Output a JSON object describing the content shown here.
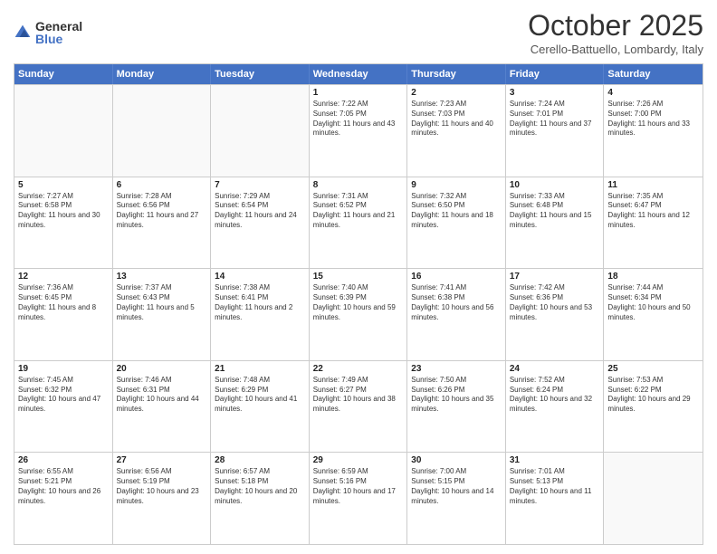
{
  "logo": {
    "general": "General",
    "blue": "Blue"
  },
  "header": {
    "month": "October 2025",
    "location": "Cerello-Battuello, Lombardy, Italy"
  },
  "days_of_week": [
    "Sunday",
    "Monday",
    "Tuesday",
    "Wednesday",
    "Thursday",
    "Friday",
    "Saturday"
  ],
  "rows": [
    [
      {
        "day": "",
        "empty": true
      },
      {
        "day": "",
        "empty": true
      },
      {
        "day": "",
        "empty": true
      },
      {
        "day": "1",
        "sunrise": "7:22 AM",
        "sunset": "7:05 PM",
        "daylight": "11 hours and 43 minutes."
      },
      {
        "day": "2",
        "sunrise": "7:23 AM",
        "sunset": "7:03 PM",
        "daylight": "11 hours and 40 minutes."
      },
      {
        "day": "3",
        "sunrise": "7:24 AM",
        "sunset": "7:01 PM",
        "daylight": "11 hours and 37 minutes."
      },
      {
        "day": "4",
        "sunrise": "7:26 AM",
        "sunset": "7:00 PM",
        "daylight": "11 hours and 33 minutes."
      }
    ],
    [
      {
        "day": "5",
        "sunrise": "7:27 AM",
        "sunset": "6:58 PM",
        "daylight": "11 hours and 30 minutes."
      },
      {
        "day": "6",
        "sunrise": "7:28 AM",
        "sunset": "6:56 PM",
        "daylight": "11 hours and 27 minutes."
      },
      {
        "day": "7",
        "sunrise": "7:29 AM",
        "sunset": "6:54 PM",
        "daylight": "11 hours and 24 minutes."
      },
      {
        "day": "8",
        "sunrise": "7:31 AM",
        "sunset": "6:52 PM",
        "daylight": "11 hours and 21 minutes."
      },
      {
        "day": "9",
        "sunrise": "7:32 AM",
        "sunset": "6:50 PM",
        "daylight": "11 hours and 18 minutes."
      },
      {
        "day": "10",
        "sunrise": "7:33 AM",
        "sunset": "6:48 PM",
        "daylight": "11 hours and 15 minutes."
      },
      {
        "day": "11",
        "sunrise": "7:35 AM",
        "sunset": "6:47 PM",
        "daylight": "11 hours and 12 minutes."
      }
    ],
    [
      {
        "day": "12",
        "sunrise": "7:36 AM",
        "sunset": "6:45 PM",
        "daylight": "11 hours and 8 minutes."
      },
      {
        "day": "13",
        "sunrise": "7:37 AM",
        "sunset": "6:43 PM",
        "daylight": "11 hours and 5 minutes."
      },
      {
        "day": "14",
        "sunrise": "7:38 AM",
        "sunset": "6:41 PM",
        "daylight": "11 hours and 2 minutes."
      },
      {
        "day": "15",
        "sunrise": "7:40 AM",
        "sunset": "6:39 PM",
        "daylight": "10 hours and 59 minutes."
      },
      {
        "day": "16",
        "sunrise": "7:41 AM",
        "sunset": "6:38 PM",
        "daylight": "10 hours and 56 minutes."
      },
      {
        "day": "17",
        "sunrise": "7:42 AM",
        "sunset": "6:36 PM",
        "daylight": "10 hours and 53 minutes."
      },
      {
        "day": "18",
        "sunrise": "7:44 AM",
        "sunset": "6:34 PM",
        "daylight": "10 hours and 50 minutes."
      }
    ],
    [
      {
        "day": "19",
        "sunrise": "7:45 AM",
        "sunset": "6:32 PM",
        "daylight": "10 hours and 47 minutes."
      },
      {
        "day": "20",
        "sunrise": "7:46 AM",
        "sunset": "6:31 PM",
        "daylight": "10 hours and 44 minutes."
      },
      {
        "day": "21",
        "sunrise": "7:48 AM",
        "sunset": "6:29 PM",
        "daylight": "10 hours and 41 minutes."
      },
      {
        "day": "22",
        "sunrise": "7:49 AM",
        "sunset": "6:27 PM",
        "daylight": "10 hours and 38 minutes."
      },
      {
        "day": "23",
        "sunrise": "7:50 AM",
        "sunset": "6:26 PM",
        "daylight": "10 hours and 35 minutes."
      },
      {
        "day": "24",
        "sunrise": "7:52 AM",
        "sunset": "6:24 PM",
        "daylight": "10 hours and 32 minutes."
      },
      {
        "day": "25",
        "sunrise": "7:53 AM",
        "sunset": "6:22 PM",
        "daylight": "10 hours and 29 minutes."
      }
    ],
    [
      {
        "day": "26",
        "sunrise": "6:55 AM",
        "sunset": "5:21 PM",
        "daylight": "10 hours and 26 minutes."
      },
      {
        "day": "27",
        "sunrise": "6:56 AM",
        "sunset": "5:19 PM",
        "daylight": "10 hours and 23 minutes."
      },
      {
        "day": "28",
        "sunrise": "6:57 AM",
        "sunset": "5:18 PM",
        "daylight": "10 hours and 20 minutes."
      },
      {
        "day": "29",
        "sunrise": "6:59 AM",
        "sunset": "5:16 PM",
        "daylight": "10 hours and 17 minutes."
      },
      {
        "day": "30",
        "sunrise": "7:00 AM",
        "sunset": "5:15 PM",
        "daylight": "10 hours and 14 minutes."
      },
      {
        "day": "31",
        "sunrise": "7:01 AM",
        "sunset": "5:13 PM",
        "daylight": "10 hours and 11 minutes."
      },
      {
        "day": "",
        "empty": true
      }
    ]
  ]
}
